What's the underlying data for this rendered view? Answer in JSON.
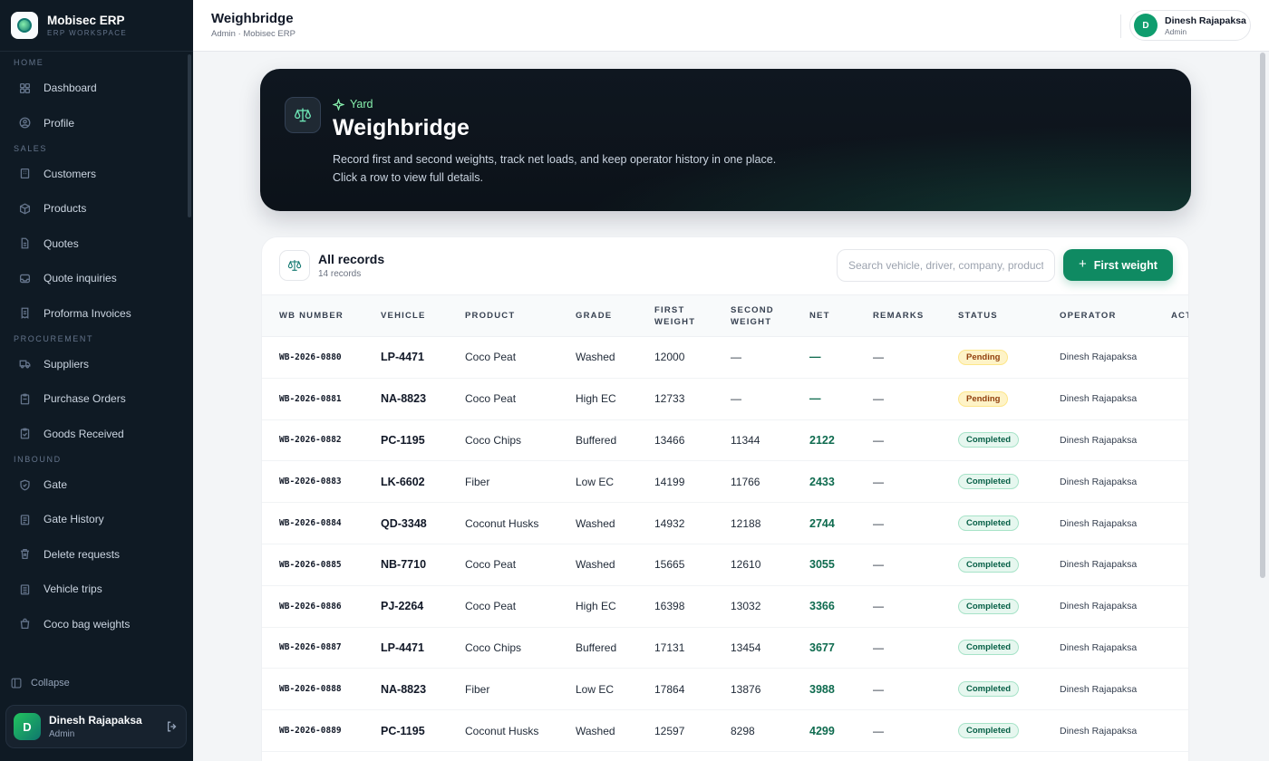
{
  "brand": {
    "name": "Mobisec ERP",
    "subtitle": "ERP WORKSPACE"
  },
  "sidebar": {
    "sections": [
      {
        "title": "HOME",
        "items": [
          {
            "label": "Dashboard",
            "icon": "grid-icon"
          },
          {
            "label": "Profile",
            "icon": "user-circle-icon"
          }
        ]
      },
      {
        "title": "SALES",
        "items": [
          {
            "label": "Customers",
            "icon": "building-icon"
          },
          {
            "label": "Products",
            "icon": "box-icon"
          },
          {
            "label": "Quotes",
            "icon": "document-icon"
          },
          {
            "label": "Quote inquiries",
            "icon": "inbox-icon"
          },
          {
            "label": "Proforma Invoices",
            "icon": "receipt-icon"
          }
        ]
      },
      {
        "title": "PROCUREMENT",
        "items": [
          {
            "label": "Suppliers",
            "icon": "truck-icon"
          },
          {
            "label": "Purchase Orders",
            "icon": "clipboard-icon"
          },
          {
            "label": "Goods Received",
            "icon": "clipboard-check-icon"
          }
        ]
      },
      {
        "title": "INBOUND",
        "items": [
          {
            "label": "Gate",
            "icon": "shield-icon"
          },
          {
            "label": "Gate History",
            "icon": "history-icon"
          },
          {
            "label": "Delete requests",
            "icon": "trash-icon"
          },
          {
            "label": "Vehicle trips",
            "icon": "route-icon"
          },
          {
            "label": "Coco bag weights",
            "icon": "bag-icon"
          }
        ]
      }
    ],
    "collapse_label": "Collapse",
    "user": {
      "initial": "D",
      "name": "Dinesh Rajapaksa",
      "role": "Admin"
    }
  },
  "header": {
    "title": "Weighbridge",
    "breadcrumb": "Admin · Mobisec ERP",
    "user": {
      "initial": "D",
      "name": "Dinesh Rajapaksa",
      "role": "Admin"
    }
  },
  "hero": {
    "tag": "Yard",
    "title": "Weighbridge",
    "description_line1": "Record first and second weights, track net loads, and keep operator history in one place.",
    "description_line2": "Click a row to view full details."
  },
  "records": {
    "title": "All records",
    "count": "14 records",
    "search_placeholder": "Search vehicle, driver, company, product",
    "search_value": "",
    "add_button": "First weight",
    "columns": [
      "WB NUMBER",
      "VEHICLE",
      "PRODUCT",
      "GRADE",
      "FIRST WEIGHT",
      "SECOND WEIGHT",
      "NET",
      "REMARKS",
      "STATUS",
      "OPERATOR",
      "ACT"
    ],
    "rows": [
      {
        "wb": "WB-2026-0880",
        "vehicle": "LP-4471",
        "product": "Coco Peat",
        "grade": "Washed",
        "first": "12000",
        "second": "—",
        "net": "—",
        "remarks": "—",
        "status": "Pending",
        "operator": "Dinesh Rajapaksa"
      },
      {
        "wb": "WB-2026-0881",
        "vehicle": "NA-8823",
        "product": "Coco Peat",
        "grade": "High EC",
        "first": "12733",
        "second": "—",
        "net": "—",
        "remarks": "—",
        "status": "Pending",
        "operator": "Dinesh Rajapaksa"
      },
      {
        "wb": "WB-2026-0882",
        "vehicle": "PC-1195",
        "product": "Coco Chips",
        "grade": "Buffered",
        "first": "13466",
        "second": "11344",
        "net": "2122",
        "remarks": "—",
        "status": "Completed",
        "operator": "Dinesh Rajapaksa"
      },
      {
        "wb": "WB-2026-0883",
        "vehicle": "LK-6602",
        "product": "Fiber",
        "grade": "Low EC",
        "first": "14199",
        "second": "11766",
        "net": "2433",
        "remarks": "—",
        "status": "Completed",
        "operator": "Dinesh Rajapaksa"
      },
      {
        "wb": "WB-2026-0884",
        "vehicle": "QD-3348",
        "product": "Coconut Husks",
        "grade": "Washed",
        "first": "14932",
        "second": "12188",
        "net": "2744",
        "remarks": "—",
        "status": "Completed",
        "operator": "Dinesh Rajapaksa"
      },
      {
        "wb": "WB-2026-0885",
        "vehicle": "NB-7710",
        "product": "Coco Peat",
        "grade": "Washed",
        "first": "15665",
        "second": "12610",
        "net": "3055",
        "remarks": "—",
        "status": "Completed",
        "operator": "Dinesh Rajapaksa"
      },
      {
        "wb": "WB-2026-0886",
        "vehicle": "PJ-2264",
        "product": "Coco Peat",
        "grade": "High EC",
        "first": "16398",
        "second": "13032",
        "net": "3366",
        "remarks": "—",
        "status": "Completed",
        "operator": "Dinesh Rajapaksa"
      },
      {
        "wb": "WB-2026-0887",
        "vehicle": "LP-4471",
        "product": "Coco Chips",
        "grade": "Buffered",
        "first": "17131",
        "second": "13454",
        "net": "3677",
        "remarks": "—",
        "status": "Completed",
        "operator": "Dinesh Rajapaksa"
      },
      {
        "wb": "WB-2026-0888",
        "vehicle": "NA-8823",
        "product": "Fiber",
        "grade": "Low EC",
        "first": "17864",
        "second": "13876",
        "net": "3988",
        "remarks": "—",
        "status": "Completed",
        "operator": "Dinesh Rajapaksa"
      },
      {
        "wb": "WB-2026-0889",
        "vehicle": "PC-1195",
        "product": "Coconut Husks",
        "grade": "Washed",
        "first": "12597",
        "second": "8298",
        "net": "4299",
        "remarks": "—",
        "status": "Completed",
        "operator": "Dinesh Rajapaksa"
      }
    ]
  },
  "colors": {
    "accent": "#0f8a62",
    "sidebar_bg": "#0f1a24",
    "hero_bg": "#0f1720",
    "pending": "#fef3c7",
    "completed": "#e6f7ef"
  }
}
